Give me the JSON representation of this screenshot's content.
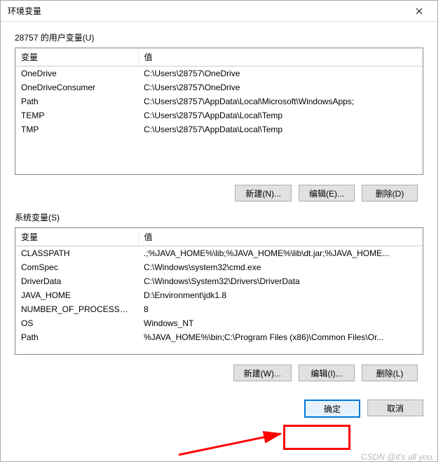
{
  "title": "环境变量",
  "user_section_label": "28757 的用户变量(U)",
  "sys_section_label": "系统变量(S)",
  "headers": {
    "var": "变量",
    "val": "值"
  },
  "user_vars": [
    {
      "name": "OneDrive",
      "value": "C:\\Users\\28757\\OneDrive"
    },
    {
      "name": "OneDriveConsumer",
      "value": "C:\\Users\\28757\\OneDrive"
    },
    {
      "name": "Path",
      "value": "C:\\Users\\28757\\AppData\\Local\\Microsoft\\WindowsApps;"
    },
    {
      "name": "TEMP",
      "value": "C:\\Users\\28757\\AppData\\Local\\Temp"
    },
    {
      "name": "TMP",
      "value": "C:\\Users\\28757\\AppData\\Local\\Temp"
    }
  ],
  "sys_vars": [
    {
      "name": "CLASSPATH",
      "value": ".;%JAVA_HOME%\\lib;%JAVA_HOME%\\lib\\dt.jar;%JAVA_HOME..."
    },
    {
      "name": "ComSpec",
      "value": "C:\\Windows\\system32\\cmd.exe"
    },
    {
      "name": "DriverData",
      "value": "C:\\Windows\\System32\\Drivers\\DriverData"
    },
    {
      "name": "JAVA_HOME",
      "value": "D:\\Environment\\jdk1.8"
    },
    {
      "name": "NUMBER_OF_PROCESSORS",
      "value": "8"
    },
    {
      "name": "OS",
      "value": "Windows_NT"
    },
    {
      "name": "Path",
      "value": "%JAVA_HOME%\\bin;C:\\Program Files (x86)\\Common Files\\Or..."
    }
  ],
  "buttons": {
    "user_new": "新建(N)...",
    "user_edit": "编辑(E)...",
    "user_del": "删除(D)",
    "sys_new": "新建(W)...",
    "sys_edit": "编辑(I)...",
    "sys_del": "删除(L)",
    "ok": "确定",
    "cancel": "取消"
  },
  "watermark": "CSDN @it's all you."
}
